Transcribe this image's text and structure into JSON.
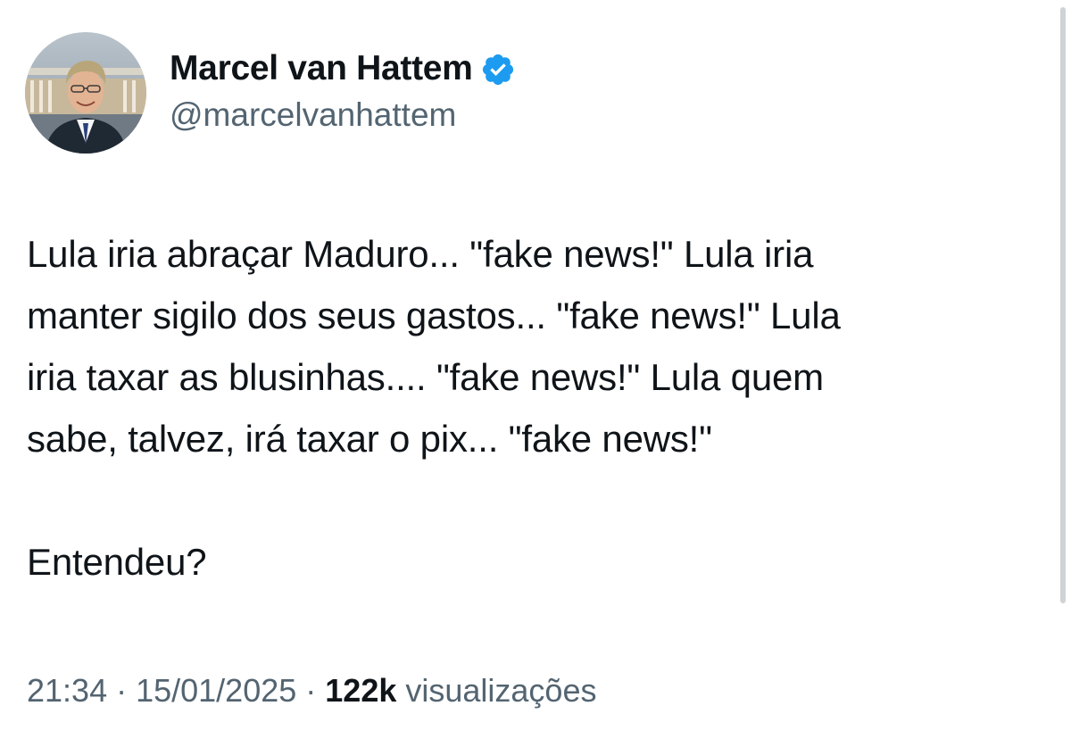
{
  "author": {
    "display_name": "Marcel van Hattem",
    "handle": "@marcelvanhattem",
    "verified_icon": "verified-badge-icon",
    "verified_color": "#1d9bf0"
  },
  "tweet": {
    "text": "Lula iria abraçar Maduro... \"fake news!\" Lula iria\nmanter sigilo dos seus gastos... \"fake news!\" Lula\niria taxar as blusinhas.... \"fake news!\" Lula quem\nsabe, talvez, irá taxar o pix... \"fake news!\"\n\nEntendeu?",
    "time": "21:34",
    "separator": "·",
    "date": "15/01/2025",
    "views_count": "122k",
    "views_label": "visualizações"
  },
  "colors": {
    "text_primary": "#0f1419",
    "text_secondary": "#536471",
    "background": "#ffffff"
  }
}
